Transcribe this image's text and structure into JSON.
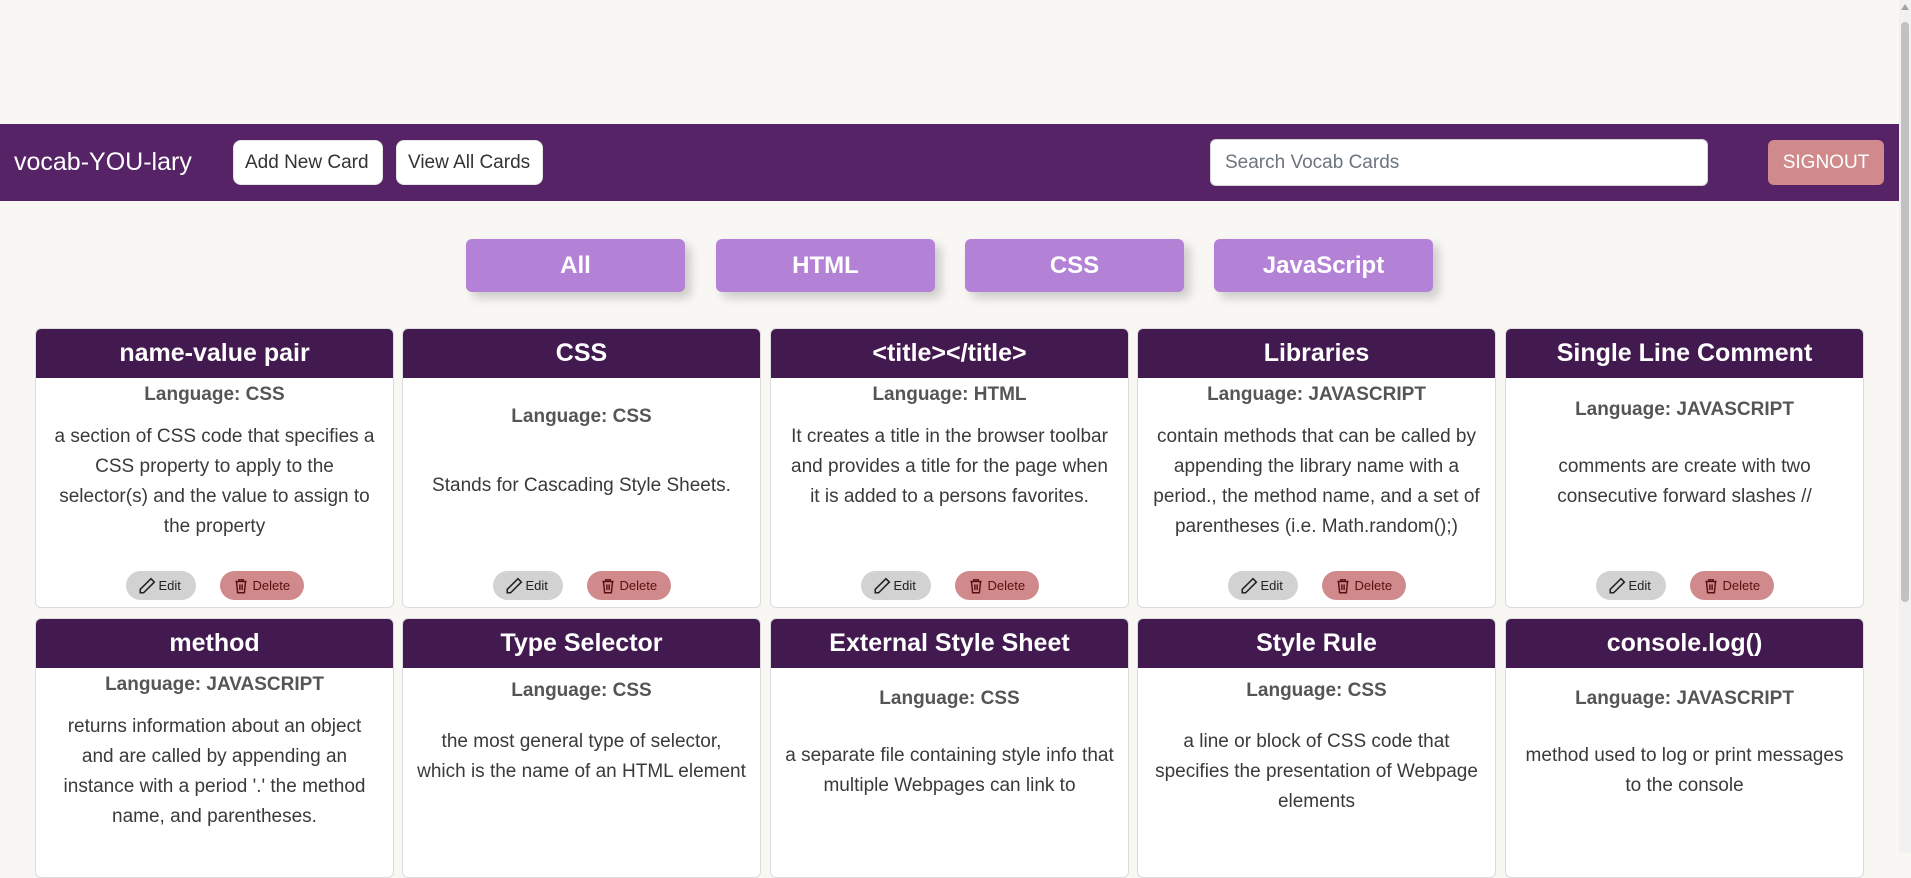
{
  "navbar": {
    "brand": "vocab-YOU-lary",
    "add_label": "Add New Card",
    "view_label": "View All Cards",
    "search_placeholder": "Search Vocab Cards",
    "signout_label": "SIGNOUT"
  },
  "filters": [
    "All",
    "HTML",
    "CSS",
    "JavaScript"
  ],
  "card_actions": {
    "edit_label": "Edit",
    "delete_label": "Delete"
  },
  "cards": [
    {
      "title": "name-value pair",
      "language": "Language: CSS",
      "definition": "a section of CSS code that specifies a CSS property to apply to the selector(s) and the value to assign to the property"
    },
    {
      "title": "CSS",
      "language": "Language: CSS",
      "definition": "Stands for Cascading Style Sheets."
    },
    {
      "title": "<title></title>",
      "language": "Language: HTML",
      "definition": "It creates a title in the browser toolbar and provides a title for the page when it is added to a persons favorites."
    },
    {
      "title": "Libraries",
      "language": "Language: JAVASCRIPT",
      "definition": "contain methods that can be called by appending the library name with a period., the method name, and a set of parentheses (i.e. Math.random();)"
    },
    {
      "title": "Single Line Comment",
      "language": "Language: JAVASCRIPT",
      "definition": "comments are create with two consecutive forward slashes //"
    },
    {
      "title": "method",
      "language": "Language: JAVASCRIPT",
      "definition": "returns information about an object and are called by appending an instance with a period '.' the method name, and parentheses."
    },
    {
      "title": "Type Selector",
      "language": "Language: CSS",
      "definition": "the most general type of selector, which is the name of an HTML element"
    },
    {
      "title": "External Style Sheet",
      "language": "Language: CSS",
      "definition": "a separate file containing style info that multiple Webpages can link to"
    },
    {
      "title": "Style Rule",
      "language": "Language: CSS",
      "definition": "a line or block of CSS code that specifies the presentation of Webpage elements"
    },
    {
      "title": "console.log()",
      "language": "Language: JAVASCRIPT",
      "definition": "method used to log or print messages to the console"
    }
  ]
}
